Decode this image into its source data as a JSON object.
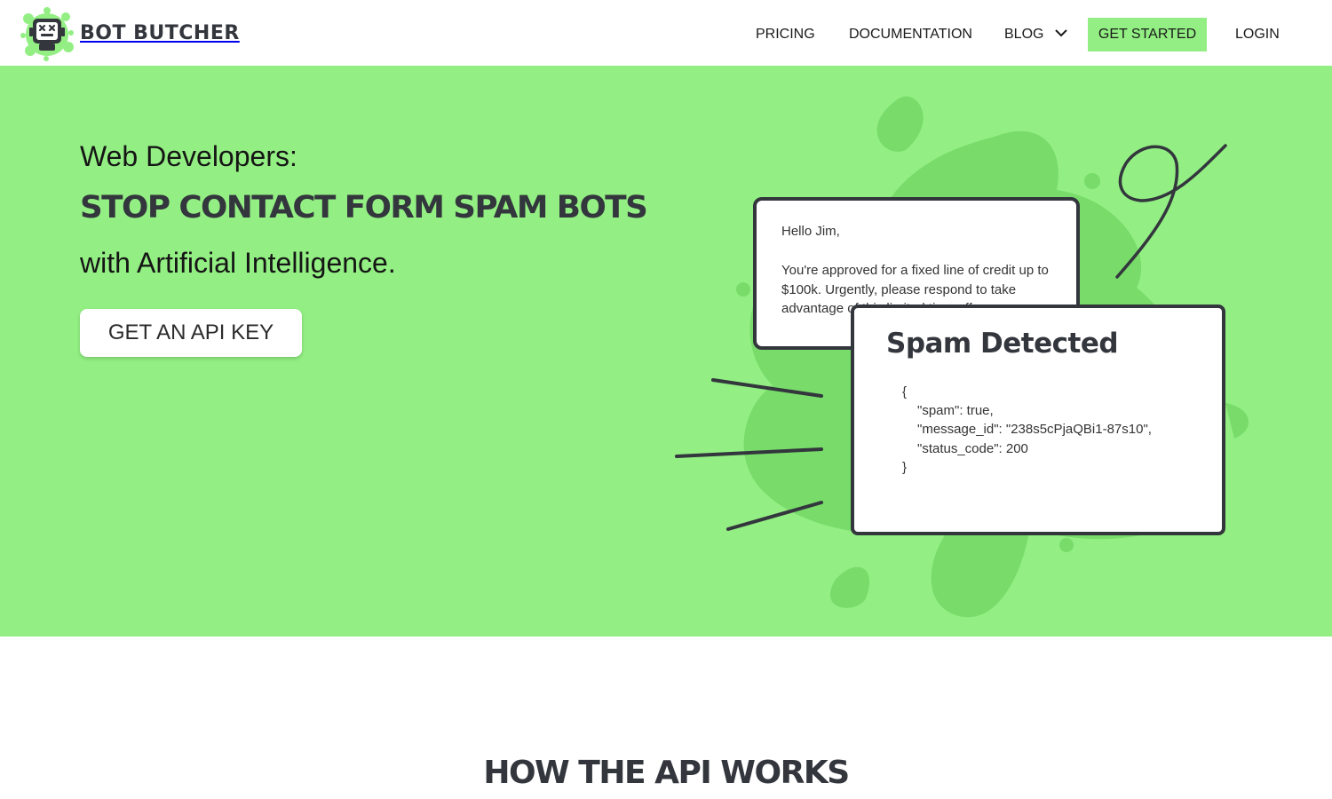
{
  "brand": {
    "name": "BOT BUTCHER",
    "colors": {
      "accent": "#93ef83",
      "accent_dark": "#78db6a",
      "ink": "#33363d"
    }
  },
  "nav": {
    "items": [
      {
        "label": "PRICING"
      },
      {
        "label": "DOCUMENTATION"
      },
      {
        "label": "BLOG",
        "icon": "chevron-down-icon"
      },
      {
        "label": "GET STARTED"
      },
      {
        "label": "LOGIN"
      }
    ]
  },
  "hero": {
    "kicker": "Web Developers:",
    "title": "STOP CONTACT FORM SPAM BOTS",
    "subtitle": "with Artificial Intelligence.",
    "cta": "GET AN API KEY"
  },
  "email": {
    "greeting": "Hello Jim,",
    "body": "You're approved for a fixed line of credit up to $100k. Urgently, please respond to take advantage of this limited time offer."
  },
  "result": {
    "title": "Spam Detected",
    "json_lines": [
      "{",
      "\"spam\": true,",
      "\"message_id\": \"238s5cPjaQBi1-87s10\",",
      "\"status_code\": 200",
      "}"
    ]
  },
  "section": {
    "title": "HOW THE API WORKS"
  }
}
